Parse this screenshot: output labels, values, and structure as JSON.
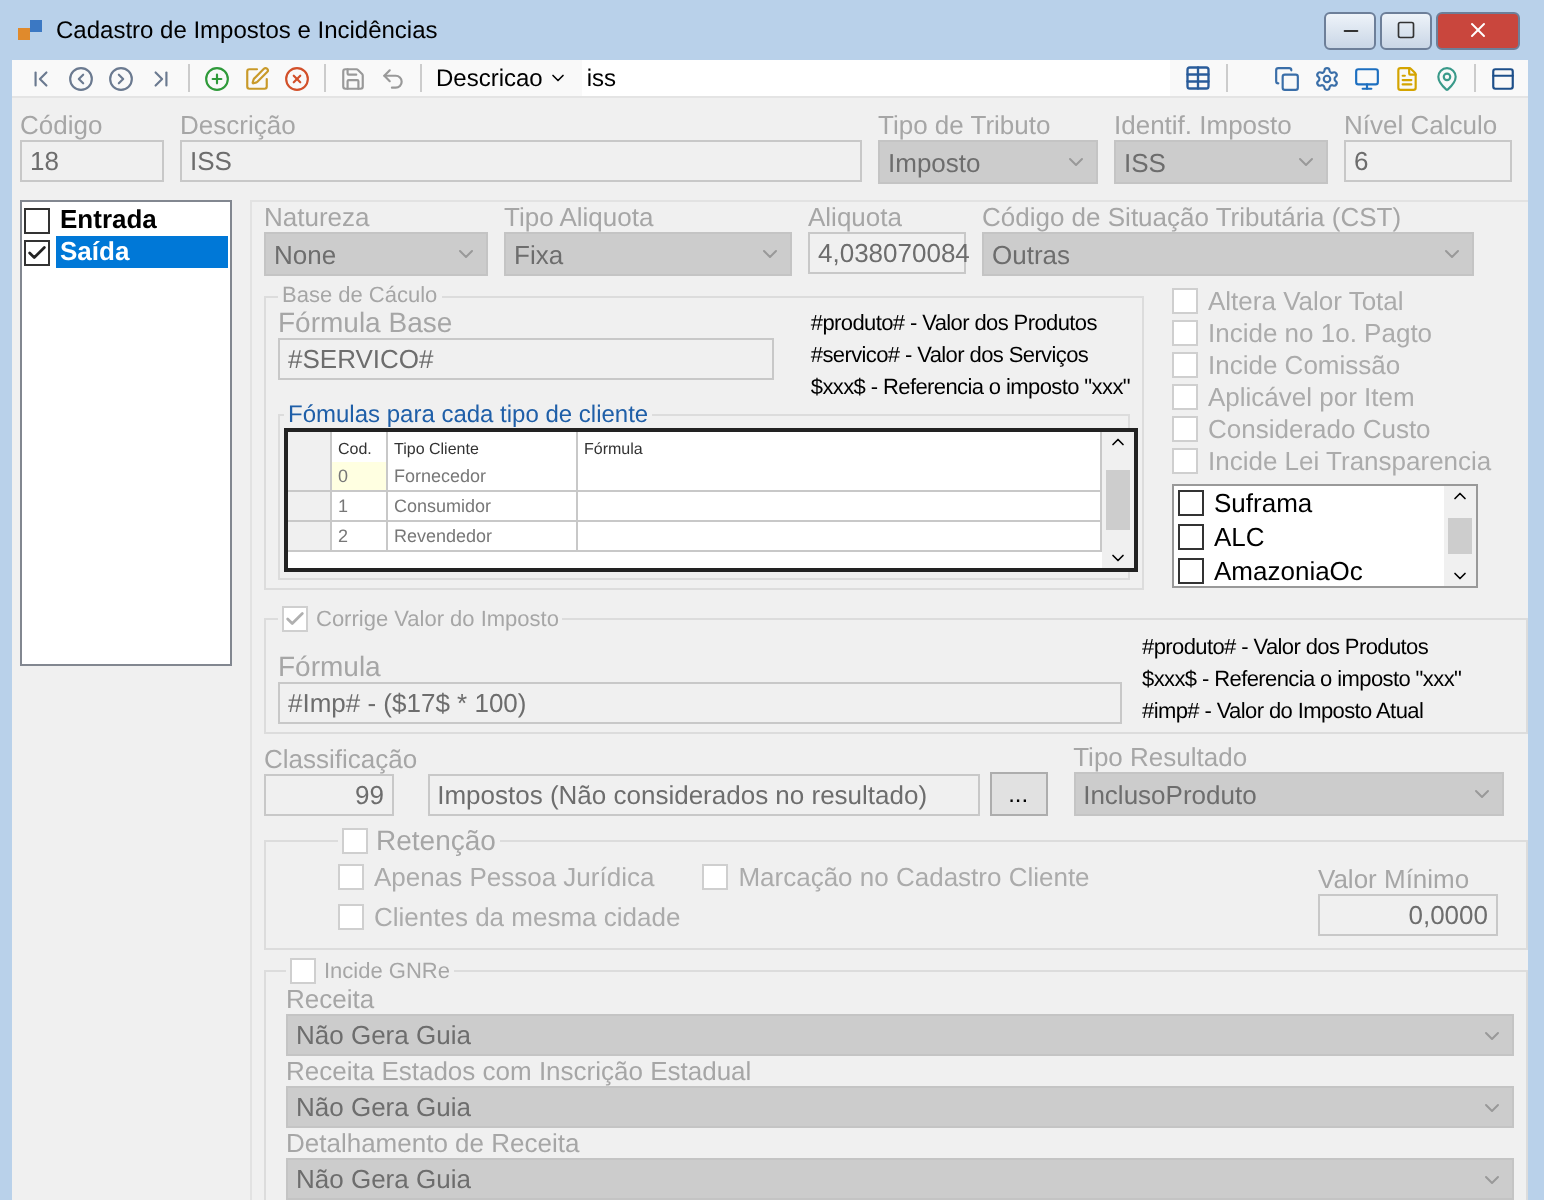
{
  "window": {
    "title": "Cadastro de Impostos e Incidências"
  },
  "toolbar": {
    "search_field": {
      "label": "Descricao",
      "value": "iss"
    }
  },
  "header": {
    "fields": [
      {
        "label": "Código",
        "value": "18",
        "kind": "text"
      },
      {
        "label": "Descrição",
        "value": "ISS",
        "kind": "text"
      },
      {
        "label": "Tipo de Tributo",
        "value": "Imposto",
        "kind": "combo"
      },
      {
        "label": "Identif. Imposto",
        "value": "ISS",
        "kind": "combo"
      },
      {
        "label": "Nível Calculo",
        "value": "6",
        "kind": "text"
      }
    ]
  },
  "operations": [
    {
      "label": "Entrada",
      "checked": false,
      "selected": false
    },
    {
      "label": "Saída",
      "checked": true,
      "selected": true
    }
  ],
  "tax_fields": [
    {
      "label": "Natureza",
      "value": "None",
      "kind": "combo"
    },
    {
      "label": "Tipo Aliquota",
      "value": "Fixa",
      "kind": "combo"
    },
    {
      "label": "Aliquota",
      "value": "4,038070084",
      "kind": "text"
    },
    {
      "label": "Código de Situação Tributária (CST)",
      "value": "Outras",
      "kind": "combo"
    }
  ],
  "base_calculo": {
    "title": "Base de Cáculo",
    "formula_label": "Fórmula Base",
    "formula": "#SERVICO#",
    "legend": [
      "#produto# - Valor dos Produtos",
      "#servico# - Valor dos Serviços",
      "$xxx$ - Referencia o imposto \"xxx\""
    ],
    "client_formulas": {
      "title": "Fómulas para cada tipo de cliente",
      "columns": [
        "Cod.",
        "Tipo Cliente",
        "Fórmula"
      ],
      "rows": [
        {
          "cod": "0",
          "tipo": "Fornecedor",
          "selected": true
        },
        {
          "cod": "1",
          "tipo": "Consumidor",
          "selected": false
        },
        {
          "cod": "2",
          "tipo": "Revendedor",
          "selected": false
        }
      ]
    }
  },
  "options": [
    {
      "label": "Altera Valor Total",
      "checked": false,
      "disabled": true
    },
    {
      "label": "Incide no 1o. Pagto",
      "checked": false,
      "disabled": true
    },
    {
      "label": "Incide Comissão",
      "checked": false,
      "disabled": true
    },
    {
      "label": "Aplicável por Item",
      "checked": false,
      "disabled": true
    },
    {
      "label": "Considerado Custo",
      "checked": false,
      "disabled": true
    },
    {
      "label": "Incide Lei Transparencia",
      "checked": false,
      "disabled": true
    }
  ],
  "regions": [
    {
      "label": "Suframa",
      "checked": false
    },
    {
      "label": "ALC",
      "checked": false
    },
    {
      "label": "AmazoniaOc",
      "checked": false
    }
  ],
  "correction": {
    "label": "Corrige Valor do Imposto",
    "checked": true,
    "formula_label": "Fórmula",
    "formula": "#Imp# - ($17$ * 100)",
    "legend": [
      "#produto# - Valor dos Produtos",
      "$xxx$ - Referencia o imposto \"xxx\"",
      "#imp# - Valor do Imposto Atual"
    ]
  },
  "classification": {
    "label": "Classificação",
    "code": "99",
    "description": "Impostos (Não considerados no resultado)",
    "browse": "...",
    "result_label": "Tipo Resultado",
    "result": "InclusoProduto"
  },
  "retention": {
    "label": "Retenção",
    "checked": false,
    "options": [
      {
        "label": "Apenas Pessoa Jurídica",
        "checked": false
      },
      {
        "label": "Marcação no Cadastro Cliente",
        "checked": false
      },
      {
        "label": "Clientes da mesma cidade",
        "checked": false
      }
    ],
    "min_label": "Valor Mínimo",
    "min_value": "0,0000"
  },
  "gnre": {
    "label": "Incide GNRe",
    "checked": false,
    "fields": [
      {
        "label": "Receita",
        "value": "Não Gera Guia"
      },
      {
        "label": "Receita Estados com Inscrição Estadual",
        "value": "Não Gera Guia"
      },
      {
        "label": "Detalhamento de Receita",
        "value": "Não Gera Guia"
      }
    ]
  }
}
